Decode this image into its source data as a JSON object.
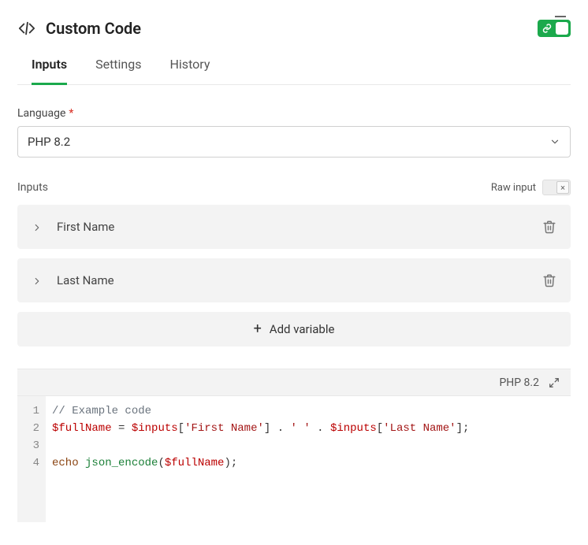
{
  "header": {
    "title": "Custom Code"
  },
  "tabs": [
    {
      "label": "Inputs",
      "active": true
    },
    {
      "label": "Settings",
      "active": false
    },
    {
      "label": "History",
      "active": false
    }
  ],
  "languageField": {
    "label": "Language",
    "required": "*",
    "value": "PHP 8.2"
  },
  "inputsSection": {
    "label": "Inputs",
    "rawLabel": "Raw input",
    "rawCloseGlyph": "×",
    "items": [
      {
        "name": "First Name"
      },
      {
        "name": "Last Name"
      }
    ],
    "addLabel": "Add variable",
    "addGlyph": "+"
  },
  "editor": {
    "langBadge": "PHP 8.2",
    "lines": [
      "1",
      "2",
      "3",
      "4"
    ],
    "code": {
      "l1_comment": "// Example code",
      "l2_var1": "$fullName",
      "l2_eq": " = ",
      "l2_inputs1": "$inputs",
      "l2_key1": "'First Name'",
      "l2_cat1": " . ",
      "l2_space": "' '",
      "l2_cat2": " . ",
      "l2_inputs2": "$inputs",
      "l2_key2": "'Last Name'",
      "l2_semi": ";",
      "l4_echo": "echo",
      "l4_func": "json_encode",
      "l4_var": "$fullName",
      "l4_close": ");"
    }
  }
}
